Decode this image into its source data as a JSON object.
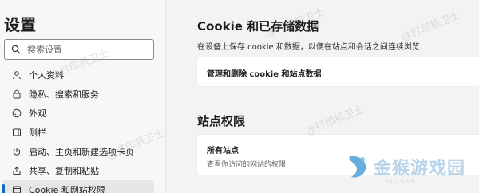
{
  "sidebar": {
    "title": "设置",
    "search_placeholder": "搜索设置",
    "items": [
      {
        "label": "个人资料",
        "icon": "profile-icon"
      },
      {
        "label": "隐私、搜索和服务",
        "icon": "lock-icon"
      },
      {
        "label": "外观",
        "icon": "palette-icon"
      },
      {
        "label": "侧栏",
        "icon": "sidebar-icon"
      },
      {
        "label": "启动、主页和新建选项卡页",
        "icon": "power-icon"
      },
      {
        "label": "共享、复制和粘贴",
        "icon": "share-icon"
      },
      {
        "label": "Cookie 和网站权限",
        "icon": "site-permissions-icon",
        "active": true
      }
    ]
  },
  "main": {
    "section1_title": "Cookie 和已存储数据",
    "section1_desc": "在设备上保存 cookie 和数据，以便在站点和会话之间连续浏览",
    "manage_cookie_label": "管理和删除 cookie 和站点数据",
    "section2_title": "站点权限",
    "all_sites_label": "所有站点",
    "all_sites_sub": "查看你访问的网站的权限"
  },
  "watermark": "@打印机卫士",
  "logo": {
    "text": "金猴游戏园",
    "sub": "SLOGAN"
  },
  "colors": {
    "accent": "#0f6cbd"
  }
}
